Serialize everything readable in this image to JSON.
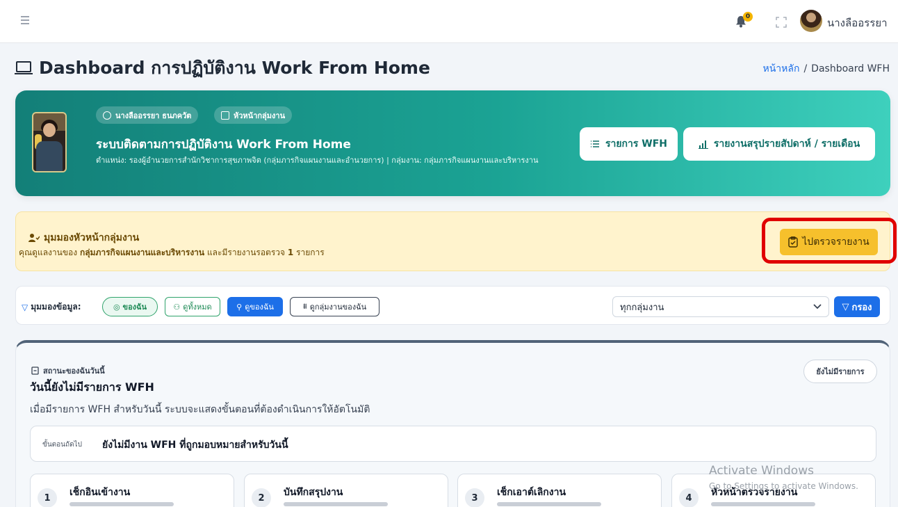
{
  "topbar": {
    "notification_count": "0",
    "user_name": "นางลืออรรยา"
  },
  "page": {
    "title": "Dashboard การปฏิบัติงาน Work From Home",
    "breadcrumb": {
      "home": "หน้าหลัก",
      "separator": "/",
      "current": "Dashboard WFH"
    }
  },
  "hero": {
    "name_pill": "นางลืออรรยา ธนภควัต",
    "role_pill": "หัวหน้ากลุ่มงาน",
    "title": "ระบบติดตามการปฏิบัติงาน Work From Home",
    "description": "ตำแหน่ง: รองผู้อำนวยการสำนักวิชาการสุขภาพจิต (กลุ่มภารกิจแผนงานและอำนวยการ) | กลุ่มงาน: กลุ่มภารกิจแผนงานและบริหารงาน",
    "btn_list": "รายการ WFH",
    "btn_report": "รายงานสรุปรายสัปดาห์ / รายเดือน"
  },
  "alert": {
    "title": "มุมมองหัวหน้ากลุ่มงาน",
    "body_prefix": "คุณดูแลงานของ ",
    "body_group": "กลุ่มภารกิจแผนงานและบริหารงาน",
    "body_mid": " และมีรายงานรอตรวจ ",
    "body_count": "1",
    "body_suffix": " รายการ",
    "button": "ไปตรวจรายงาน"
  },
  "filter": {
    "label": "มุมมองข้อมูล:",
    "chip_mine": "ของฉัน",
    "chip_all": "ดูทั้งหมด",
    "chip_view_mine": "ดูของฉัน",
    "chip_view_group": "ดูกลุ่มงานของฉัน",
    "select_value": "ทุกกลุ่มงาน",
    "button": "กรอง"
  },
  "status": {
    "caption": "สถานะของฉันวันนี้",
    "title": "วันนี้ยังไม่มีรายการ WFH",
    "description": "เมื่อมีรายการ WFH สำหรับวันนี้ ระบบจะแสดงขั้นตอนที่ต้องดำเนินการให้อัตโนมัติ",
    "badge": "ยังไม่มีรายการ",
    "next_label": "ขั้นตอนถัดไป",
    "next_value": "ยังไม่มีงาน WFH ที่ถูกมอบหมายสำหรับวันนี้",
    "steps": [
      {
        "num": "1",
        "name": "เช็กอินเข้างาน"
      },
      {
        "num": "2",
        "name": "บันทึกสรุปงาน"
      },
      {
        "num": "3",
        "name": "เช็กเอาต์เลิกงาน"
      },
      {
        "num": "4",
        "name": "หัวหน้าตรวจรายงาน"
      }
    ]
  },
  "watermark": {
    "line1": "Activate Windows",
    "line2": "Go to Settings to activate Windows."
  },
  "colors": {
    "brand_blue": "#1d6fe8",
    "teal": "#1ba394",
    "warning": "#f6c02c",
    "highlight": "#e00000"
  },
  "icons": [
    "menu-icon",
    "bell-icon",
    "expand-icon",
    "laptop-icon",
    "user-icon",
    "id-card-icon",
    "list-icon",
    "chart-icon",
    "supervisor-icon",
    "clipboard-check-icon",
    "filter-icon",
    "eye-icon",
    "users-icon",
    "person-icon",
    "sitemap-icon",
    "chevron-down-icon",
    "status-icon"
  ]
}
